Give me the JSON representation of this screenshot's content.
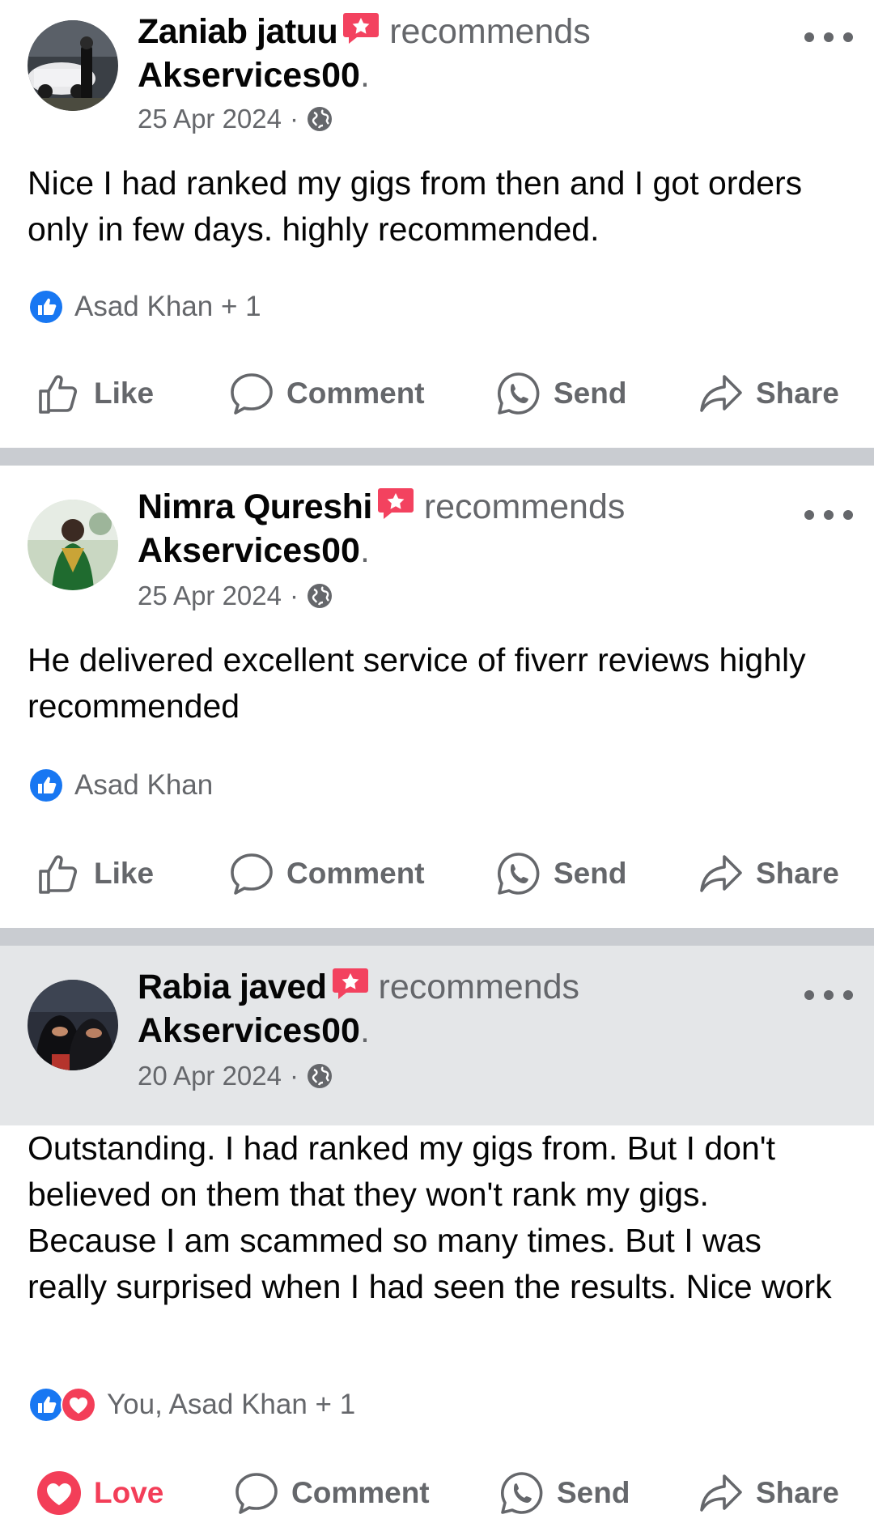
{
  "posts": [
    {
      "author": "Zaniab jatuu",
      "verb": "recommends",
      "page": "Akservices00",
      "date": "25 Apr 2024",
      "dot": "·",
      "text": "Nice I had ranked my gigs from then and I got orders only in few days. highly recommended.",
      "reactions_text": "Asad Khan + 1",
      "reaction_types": [
        "like"
      ],
      "actions": {
        "like": "Like",
        "comment": "Comment",
        "send": "Send",
        "share": "Share"
      }
    },
    {
      "author": "Nimra Qureshi",
      "verb": "recommends",
      "page": "Akservices00",
      "date": "25 Apr 2024",
      "dot": "·",
      "text": "He delivered excellent service  of fiverr reviews highly recommended",
      "reactions_text": "Asad Khan",
      "reaction_types": [
        "like"
      ],
      "actions": {
        "like": "Like",
        "comment": "Comment",
        "send": "Send",
        "share": "Share"
      }
    },
    {
      "author": "Rabia javed",
      "verb": "recommends",
      "page": "Akservices00",
      "date": "20 Apr 2024",
      "dot": "·",
      "text": "Outstanding. I had ranked my gigs from. But I don't believed on them that they won't rank my gigs. Because I am scammed so many times. But I was really surprised when I had seen the results. Nice work",
      "reactions_text": "You, Asad Khan + 1",
      "reaction_types": [
        "like",
        "love"
      ],
      "actions": {
        "like": "Love",
        "comment": "Comment",
        "send": "Send",
        "share": "Share"
      },
      "user_reaction": "love"
    }
  ],
  "colors": {
    "primary_text": "#050505",
    "secondary_text": "#65676b",
    "like_blue": "#1877f2",
    "love_red": "#f33e58",
    "divider": "#c9ccd1"
  },
  "icons": [
    "recommend-badge-icon",
    "globe-icon",
    "more-icon",
    "like-icon",
    "comment-icon",
    "whatsapp-send-icon",
    "share-icon",
    "love-icon"
  ]
}
